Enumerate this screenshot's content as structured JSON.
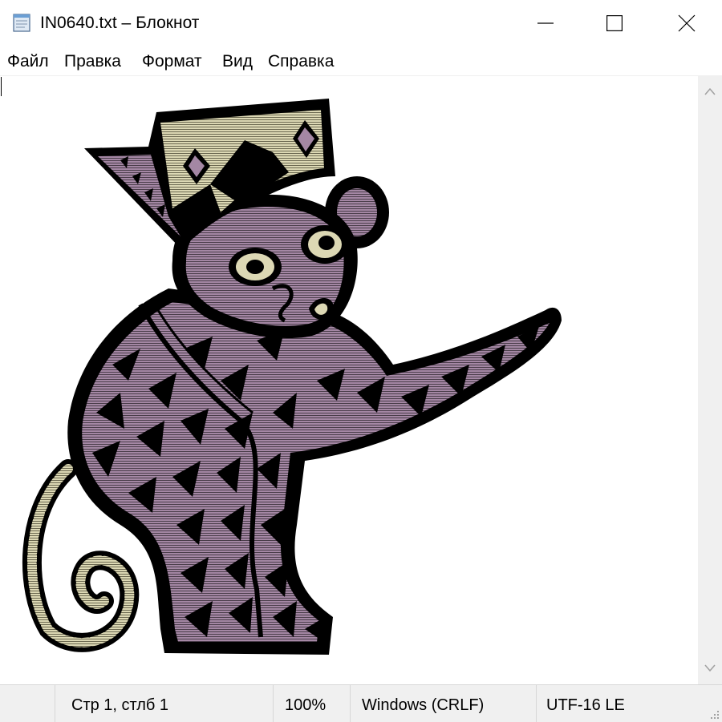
{
  "window": {
    "title": "IN0640.txt – Блокнот",
    "icon": "notepad-icon",
    "controls": [
      "minimize-icon",
      "maximize-icon",
      "close-icon"
    ]
  },
  "menu": {
    "items": [
      "Файл",
      "Правка",
      "Формат",
      "Вид",
      "Справка"
    ]
  },
  "editor": {
    "content_description_icon": "ascii-art-monkey",
    "colors": {
      "purple": "#a487a4",
      "cream": "#dcd8b4",
      "dark": "#000000"
    }
  },
  "status": {
    "position": "Стр 1, стлб 1",
    "zoom": "100%",
    "line_ending": "Windows (CRLF)",
    "encoding": "UTF-16 LE"
  }
}
